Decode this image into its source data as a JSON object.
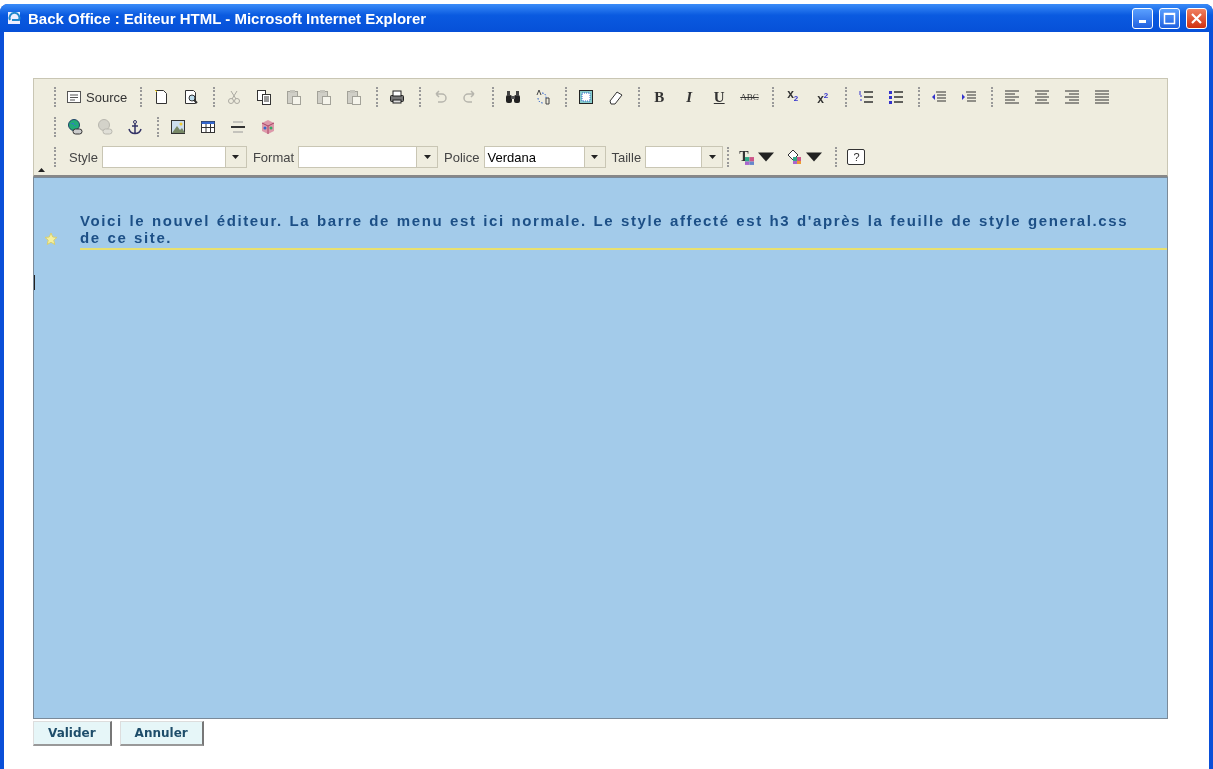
{
  "window": {
    "title": "Back Office : Editeur HTML - Microsoft Internet Explorer"
  },
  "toolbar": {
    "rows": [
      [
        {
          "kind": "source",
          "label": "Source",
          "disabled": false
        },
        {
          "kind": "separator"
        },
        {
          "kind": "new-page",
          "disabled": false
        },
        {
          "kind": "preview",
          "disabled": false
        },
        {
          "kind": "separator"
        },
        {
          "kind": "cut",
          "disabled": true
        },
        {
          "kind": "copy",
          "disabled": false
        },
        {
          "kind": "paste",
          "disabled": true
        },
        {
          "kind": "paste-text",
          "disabled": true
        },
        {
          "kind": "paste-word",
          "disabled": true
        },
        {
          "kind": "separator"
        },
        {
          "kind": "print",
          "disabled": false
        },
        {
          "kind": "separator"
        },
        {
          "kind": "undo",
          "disabled": true
        },
        {
          "kind": "redo",
          "disabled": true
        },
        {
          "kind": "separator"
        },
        {
          "kind": "find",
          "disabled": false
        },
        {
          "kind": "replace",
          "disabled": false
        },
        {
          "kind": "separator"
        },
        {
          "kind": "select-all",
          "disabled": false
        },
        {
          "kind": "eraser",
          "disabled": false
        },
        {
          "kind": "separator"
        },
        {
          "kind": "bold",
          "glyph": "B",
          "disabled": false
        },
        {
          "kind": "italic",
          "glyph": "I",
          "disabled": false
        },
        {
          "kind": "underline",
          "glyph": "U",
          "disabled": false
        },
        {
          "kind": "strike",
          "glyph": "ABC",
          "disabled": false
        },
        {
          "kind": "separator"
        },
        {
          "kind": "subscript",
          "glyph": "x$_{2}$",
          "disabled": false
        },
        {
          "kind": "superscript",
          "glyph": "x$^{2}$",
          "disabled": false
        },
        {
          "kind": "separator"
        },
        {
          "kind": "ordered-list",
          "disabled": false
        },
        {
          "kind": "bullet-list",
          "disabled": false
        },
        {
          "kind": "separator"
        },
        {
          "kind": "outdent",
          "disabled": false
        },
        {
          "kind": "indent",
          "disabled": false
        },
        {
          "kind": "separator"
        },
        {
          "kind": "align-left",
          "disabled": false
        },
        {
          "kind": "align-center",
          "disabled": false
        },
        {
          "kind": "align-right",
          "disabled": false
        },
        {
          "kind": "align-justify",
          "disabled": false
        }
      ],
      [
        {
          "kind": "link",
          "disabled": false
        },
        {
          "kind": "unlink",
          "disabled": true
        },
        {
          "kind": "anchor",
          "disabled": false
        },
        {
          "kind": "separator"
        },
        {
          "kind": "image",
          "disabled": false
        },
        {
          "kind": "table",
          "disabled": false
        },
        {
          "kind": "rule",
          "disabled": false
        },
        {
          "kind": "cube",
          "disabled": false
        }
      ],
      [
        {
          "kind": "combo",
          "label": "Style"
        },
        {
          "kind": "combo",
          "label": "Format"
        },
        {
          "kind": "combo",
          "label": "Police",
          "value": "Verdana"
        },
        {
          "kind": "combo",
          "label": "Taille"
        },
        {
          "kind": "separator"
        },
        {
          "kind": "text-color",
          "glyph": "T",
          "disabled": false
        },
        {
          "kind": "bg-color",
          "disabled": false
        },
        {
          "kind": "separator"
        },
        {
          "kind": "help",
          "glyph": "?",
          "disabled": false
        }
      ]
    ]
  },
  "editor": {
    "text": "Voici le nouvel éditeur. La barre de menu est ici normale. Le style affecté est h3 d'après la feuille de style general.css de ce site."
  },
  "buttons": [
    "Valider",
    "Annuler"
  ]
}
